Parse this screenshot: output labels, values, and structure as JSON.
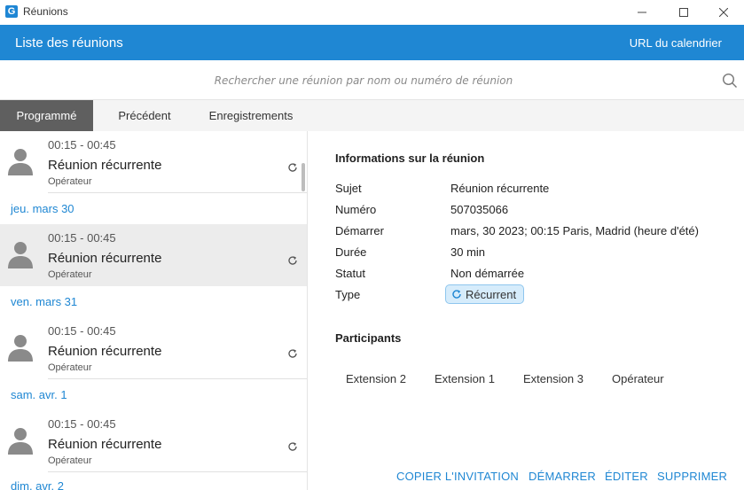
{
  "window": {
    "logo_letter": "G",
    "title": "Réunions"
  },
  "header": {
    "title": "Liste des réunions",
    "calendar_link": "URL du calendrier"
  },
  "search": {
    "placeholder": "Rechercher une réunion par nom ou numéro de réunion"
  },
  "tabs": [
    {
      "label": "Programmé",
      "active": true
    },
    {
      "label": "Précédent",
      "active": false
    },
    {
      "label": "Enregistrements",
      "active": false
    }
  ],
  "meetings": [
    {
      "time": "00:15 - 00:45",
      "title": "Réunion récurrente",
      "role": "Opérateur"
    },
    {
      "time": "00:15 - 00:45",
      "title": "Réunion récurrente",
      "role": "Opérateur"
    },
    {
      "time": "00:15 - 00:45",
      "title": "Réunion récurrente",
      "role": "Opérateur"
    },
    {
      "time": "00:15 - 00:45",
      "title": "Réunion récurrente",
      "role": "Opérateur"
    }
  ],
  "days": [
    "jeu. mars 30",
    "ven. mars 31",
    "sam. avr. 1",
    "dim. avr. 2"
  ],
  "details": {
    "heading": "Informations sur la réunion",
    "rows": [
      {
        "label": "Sujet",
        "value": "Réunion récurrente"
      },
      {
        "label": "Numéro",
        "value": "507035066"
      },
      {
        "label": "Démarrer",
        "value": "mars, 30 2023; 00:15 Paris, Madrid (heure d'été)"
      },
      {
        "label": "Durée",
        "value": "30 min"
      },
      {
        "label": "Statut",
        "value": "Non démarrée"
      },
      {
        "label": "Type",
        "value": "Récurrent"
      }
    ],
    "participants_heading": "Participants",
    "participants": [
      "Extension 2",
      "Extension 1",
      "Extension 3",
      "Opérateur"
    ]
  },
  "actions": [
    "COPIER L'INVITATION",
    "DÉMARRER",
    "ÉDITER",
    "SUPPRIMER"
  ],
  "colors": {
    "accent": "#1f87d3",
    "active_tab": "#5f5f5f",
    "selected_row": "#ececec",
    "badge_bg": "#d6ecfb"
  }
}
